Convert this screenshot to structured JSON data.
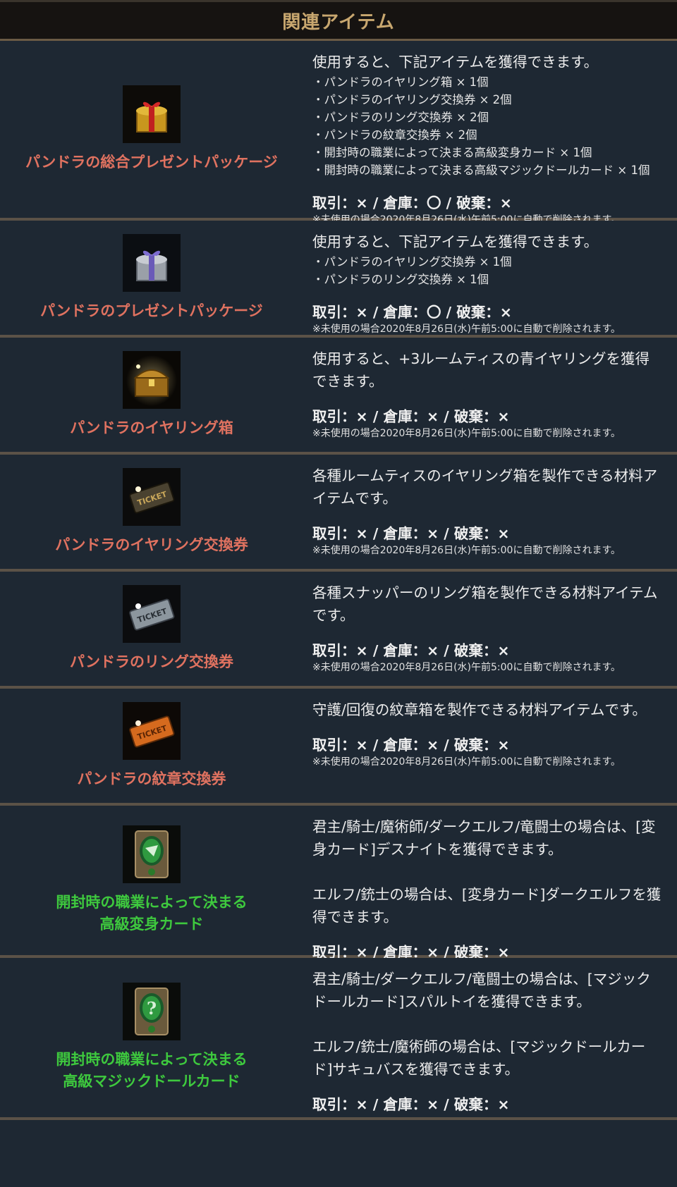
{
  "header": {
    "title": "関連アイテム"
  },
  "note": "※未使用の場合2020年8月26日(水)午前5:00に自動で削除されます。",
  "items": [
    {
      "name": [
        "パンドラの総合プレゼントパッケージ"
      ],
      "icon": "gold-gift-box-icon",
      "desc": [
        "使用すると、下記アイテムを獲得できます。"
      ],
      "list": [
        "・パンドラのイヤリング箱 × 1個",
        "・パンドラのイヤリング交換券 × 2個",
        "・パンドラのリング交換券 × 2個",
        "・パンドラの紋章交換券 × 2個",
        "・開封時の職業によって決まる高級変身カード × 1個",
        "・開封時の職業によって決まる高級マジックドールカード × 1個"
      ],
      "trade": "取引：× / 倉庫：〇 / 破棄：×"
    },
    {
      "name": [
        "パンドラのプレゼントパッケージ"
      ],
      "icon": "silver-gift-box-icon",
      "desc": [
        "使用すると、下記アイテムを獲得できます。"
      ],
      "list": [
        "・パンドラのイヤリング交換券 × 1個",
        "・パンドラのリング交換券 × 1個"
      ],
      "trade": "取引：× / 倉庫：〇 / 破棄：×"
    },
    {
      "name": [
        "パンドラのイヤリング箱"
      ],
      "icon": "treasure-chest-icon",
      "desc": [
        "使用すると、+3ルームティスの青イヤリングを獲得",
        "できます。"
      ],
      "list": [],
      "trade": "取引：× / 倉庫：× / 破棄：×"
    },
    {
      "name": [
        "パンドラのイヤリング交換券"
      ],
      "icon": "gold-ticket-icon",
      "desc": [
        "各種ルームティスのイヤリング箱を製作できる材料ア",
        "イテムです。"
      ],
      "list": [],
      "trade": "取引：× / 倉庫：× / 破棄：×"
    },
    {
      "name": [
        "パンドラのリング交換券"
      ],
      "icon": "silver-ticket-icon",
      "desc": [
        "各種スナッパーのリング箱を製作できる材料アイテム",
        "です。"
      ],
      "list": [],
      "trade": "取引：× / 倉庫：× / 破棄：×"
    },
    {
      "name": [
        "パンドラの紋章交換券"
      ],
      "icon": "orange-ticket-icon",
      "desc": [
        "守護/回復の紋章箱を製作できる材料アイテムです。"
      ],
      "list": [],
      "trade": "取引：× / 倉庫：× / 破棄：×"
    },
    {
      "name": [
        "開封時の職業によって決まる",
        "高級変身カード"
      ],
      "icon": "polymorph-card-icon",
      "desc": [
        "君主/騎士/魔術師/ダークエルフ/竜闘士の場合は、[変",
        "身カード]デスナイトを獲得できます。",
        "",
        "エルフ/銃士の場合は、[変身カード]ダークエルフを獲",
        "得できます。"
      ],
      "list": [],
      "trade": "取引：× / 倉庫：× / 破棄：×"
    },
    {
      "name": [
        "開封時の職業によって決まる",
        "高級マジックドールカード"
      ],
      "icon": "magic-doll-card-icon",
      "desc": [
        "君主/騎士/ダークエルフ/竜闘士の場合は、[マジック",
        "ドールカード]スパルトイを獲得できます。",
        "",
        "エルフ/銃士/魔術師の場合は、[マジックドールカー",
        "ド]サキュバスを獲得できます。"
      ],
      "list": [],
      "trade": "取引：× / 倉庫：× / 破棄：×"
    }
  ]
}
